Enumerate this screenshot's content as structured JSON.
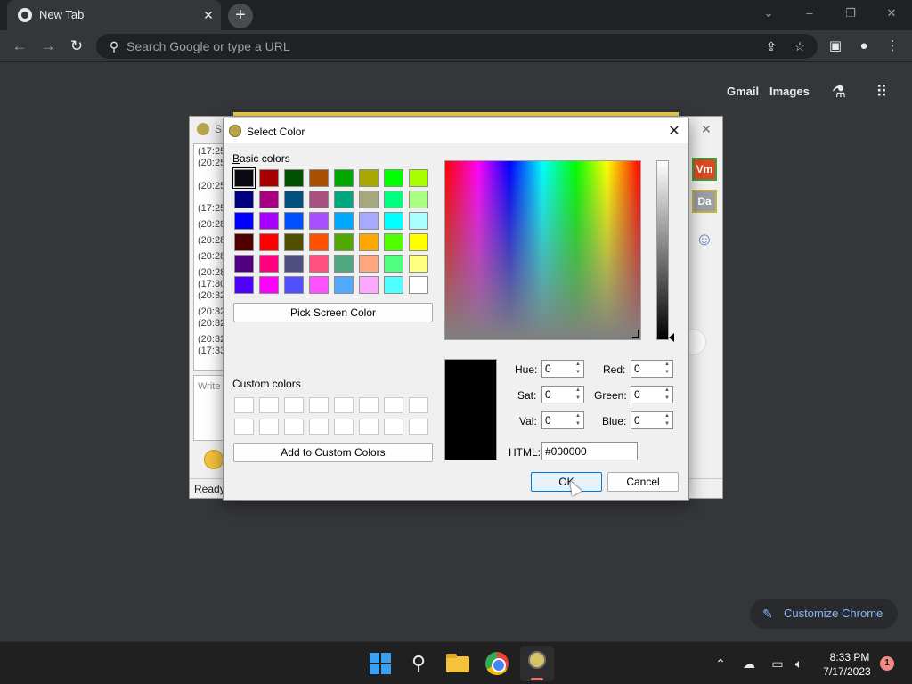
{
  "browser": {
    "tab_title": "New Tab",
    "tab_close": "✕",
    "new_tab": "+",
    "omnibox_placeholder": "Search Google or type a URL",
    "ntp_links": {
      "gmail": "Gmail",
      "images": "Images"
    },
    "customize_label": "Customize Chrome"
  },
  "chat_window": {
    "title": "S",
    "timestamps": [
      "(17:25",
      "(20:25",
      "(20:25",
      "(17:25",
      "(20:28",
      "(20:28",
      "(20:28",
      "(20:28",
      "(17:30",
      "(20:32",
      "(20:32",
      "(20:32",
      "(20:32",
      "(17:33"
    ],
    "input_placeholder": "Write",
    "status": "Ready",
    "badges": {
      "vm": "Vm",
      "da": "Da"
    }
  },
  "dialog": {
    "title": "Select Color",
    "basic_colors_label": "Basic colors",
    "basic_colors": [
      "#0a0a14",
      "#a80000",
      "#005000",
      "#a85000",
      "#00a800",
      "#a8a800",
      "#00ff00",
      "#a8ff00",
      "#000080",
      "#a80080",
      "#005080",
      "#a85080",
      "#00a880",
      "#a8a880",
      "#00ff80",
      "#a8ff80",
      "#0000ff",
      "#a800ff",
      "#0050ff",
      "#a850ff",
      "#00a8ff",
      "#a8a8ff",
      "#00ffff",
      "#a8ffff",
      "#500000",
      "#ff0000",
      "#505000",
      "#ff5000",
      "#50a800",
      "#ffa800",
      "#50ff00",
      "#ffff00",
      "#500080",
      "#ff0080",
      "#505080",
      "#ff5080",
      "#50a880",
      "#ffa880",
      "#50ff80",
      "#ffff80",
      "#5000ff",
      "#ff00ff",
      "#5050ff",
      "#ff50ff",
      "#50a8ff",
      "#ffa8ff",
      "#50ffff",
      "#ffffff"
    ],
    "selected_basic_index": 0,
    "pick_screen_color": "Pick Screen Color",
    "custom_colors_label": "Custom colors",
    "custom_colors_count": 16,
    "add_custom": "Add to Custom Colors",
    "fields": {
      "hue_label": "Hue:",
      "hue": "0",
      "sat_label": "Sat:",
      "sat": "0",
      "val_label": "Val:",
      "val": "0",
      "red_label": "Red:",
      "red": "0",
      "green_label": "Green:",
      "green": "0",
      "blue_label": "Blue:",
      "blue": "0",
      "html_label": "HTML:",
      "html": "#000000"
    },
    "ok": "OK",
    "cancel": "Cancel",
    "current_color": "#000000"
  },
  "taskbar": {
    "time": "8:33 PM",
    "date": "7/17/2023",
    "notification_count": "1"
  }
}
